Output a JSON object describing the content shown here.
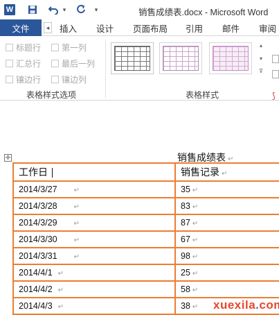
{
  "titlebar": {
    "app_icon": "W",
    "save_icon": "save-icon",
    "undo_icon": "undo-icon",
    "redo_icon": "redo-icon",
    "title": "销售成绩表.docx - Microsoft Word"
  },
  "tabs": {
    "file": "文件",
    "items": [
      "插入",
      "设计",
      "页面布局",
      "引用",
      "邮件",
      "审阅"
    ]
  },
  "ribbon": {
    "options": {
      "header_row": "标题行",
      "first_column": "第一列",
      "total_row": "汇总行",
      "last_column": "最后一列",
      "banded_rows": "镶边行",
      "banded_columns": "镶边列"
    },
    "options_group_label": "表格样式选项",
    "styles_group_label": "表格样式"
  },
  "document": {
    "title": "销售成绩表",
    "header": [
      "工作日",
      "销售记录"
    ],
    "rows": [
      [
        "2014/3/27",
        "35"
      ],
      [
        "2014/3/28",
        "83"
      ],
      [
        "2014/3/29",
        "87"
      ],
      [
        "2014/3/30",
        "67"
      ],
      [
        "2014/3/31",
        "98"
      ],
      [
        "2014/4/1",
        "25"
      ],
      [
        "2014/4/2",
        "58"
      ],
      [
        "2014/4/3",
        "38"
      ]
    ]
  },
  "colors": {
    "accent": "#2b579a",
    "table_border": "#ed7d31",
    "watermark": "#e8452c"
  },
  "watermark": {
    "left": "xuexila",
    "dot": ".",
    "right": "com"
  }
}
